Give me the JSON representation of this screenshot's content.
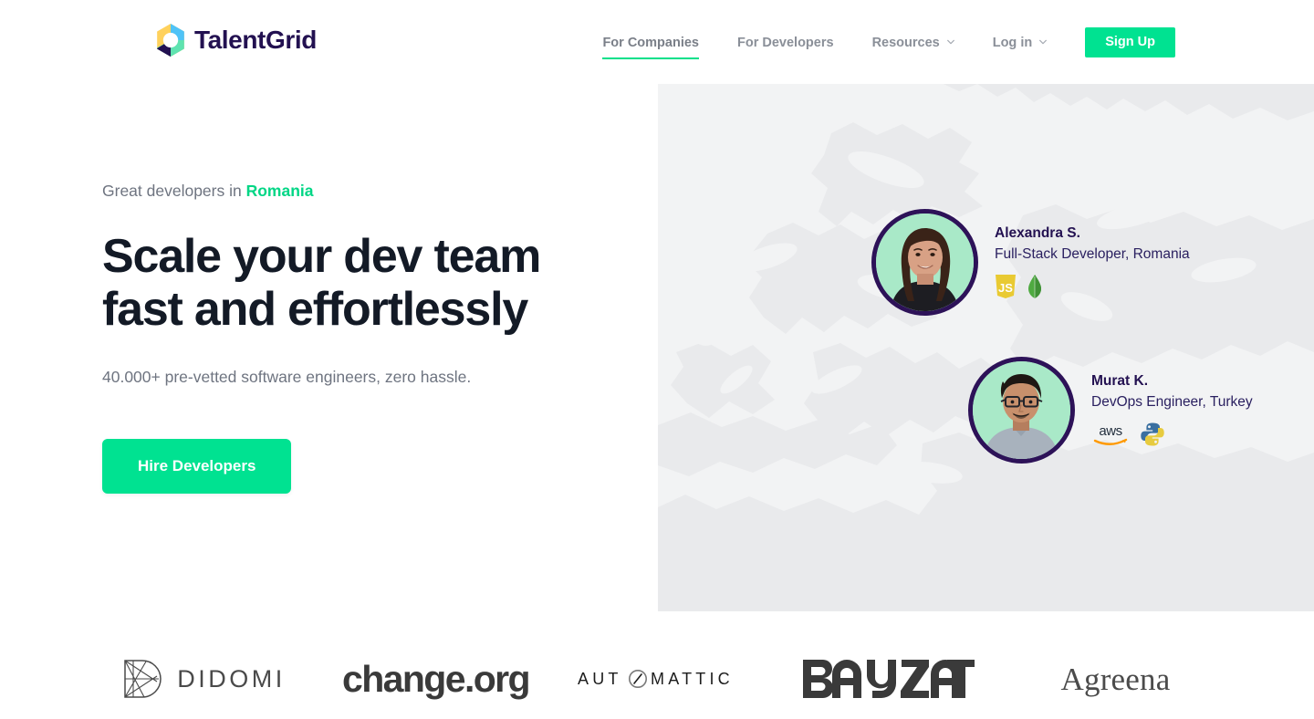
{
  "brand": {
    "name": "TalentGrid",
    "logo_icon": "talentgrid-hexagon-ring-icon",
    "colors": {
      "text": "#231151",
      "yellow": "#FFD15C",
      "cyan": "#4FC3F7",
      "mint": "#5FE3B0",
      "navy": "#231151"
    }
  },
  "nav": {
    "items": [
      {
        "label": "For Companies",
        "active": true,
        "has_caret": false
      },
      {
        "label": "For Developers",
        "active": false,
        "has_caret": false
      },
      {
        "label": "Resources",
        "active": false,
        "has_caret": true
      },
      {
        "label": "Log in",
        "active": false,
        "has_caret": true
      }
    ],
    "signup_label": "Sign Up",
    "accent_color": "#00e291"
  },
  "hero": {
    "eyebrow_prefix": "Great developers in ",
    "eyebrow_highlight": "Romania",
    "headline_line1": "Scale your dev team",
    "headline_line2": "fast and effortlessly",
    "subhead": "40.000+ pre-vetted software engineers, zero hassle.",
    "cta_label": "Hire Developers",
    "cta_color": "#00e291"
  },
  "map": {
    "icon": "europe-middle-east-map-silhouette",
    "fill": "#ebecee",
    "panel_bg": "#f2f3f4"
  },
  "developers": [
    {
      "name": "Alexandra S.",
      "role": "Full-Stack Developer, Romania",
      "avatar_icon": "avatar-photo-alexandra",
      "avatar_ring": "#2d1258",
      "avatar_bg": "#a9e9c8",
      "tech": [
        {
          "icon": "javascript-icon",
          "label": "JavaScript",
          "color": "#E9CA32"
        },
        {
          "icon": "mongodb-leaf-icon",
          "label": "MongoDB",
          "color": "#4FAA41"
        }
      ]
    },
    {
      "name": "Murat K.",
      "role": "DevOps Engineer, Turkey",
      "avatar_icon": "avatar-photo-murat",
      "avatar_ring": "#2d1258",
      "avatar_bg": "#a9e9c8",
      "tech": [
        {
          "icon": "aws-icon",
          "label": "AWS",
          "color": "#FF9900"
        },
        {
          "icon": "python-icon",
          "label": "Python",
          "color": "#366C9C"
        }
      ]
    }
  ],
  "client_logos": [
    {
      "name": "DIDOMI",
      "icon": "didomi-logo",
      "wordmark": "DIDOMI"
    },
    {
      "name": "change.org",
      "icon": "change-org-logo",
      "wordmark": "change.org"
    },
    {
      "name": "AUTOMATTIC",
      "icon": "automattic-logo",
      "wordmark": "AUTOMATTIC"
    },
    {
      "name": "BAYZAT",
      "icon": "bayzat-logo",
      "wordmark": "BAYZAT"
    },
    {
      "name": "Agreena",
      "icon": "agreena-logo",
      "wordmark": "Agreena"
    }
  ]
}
